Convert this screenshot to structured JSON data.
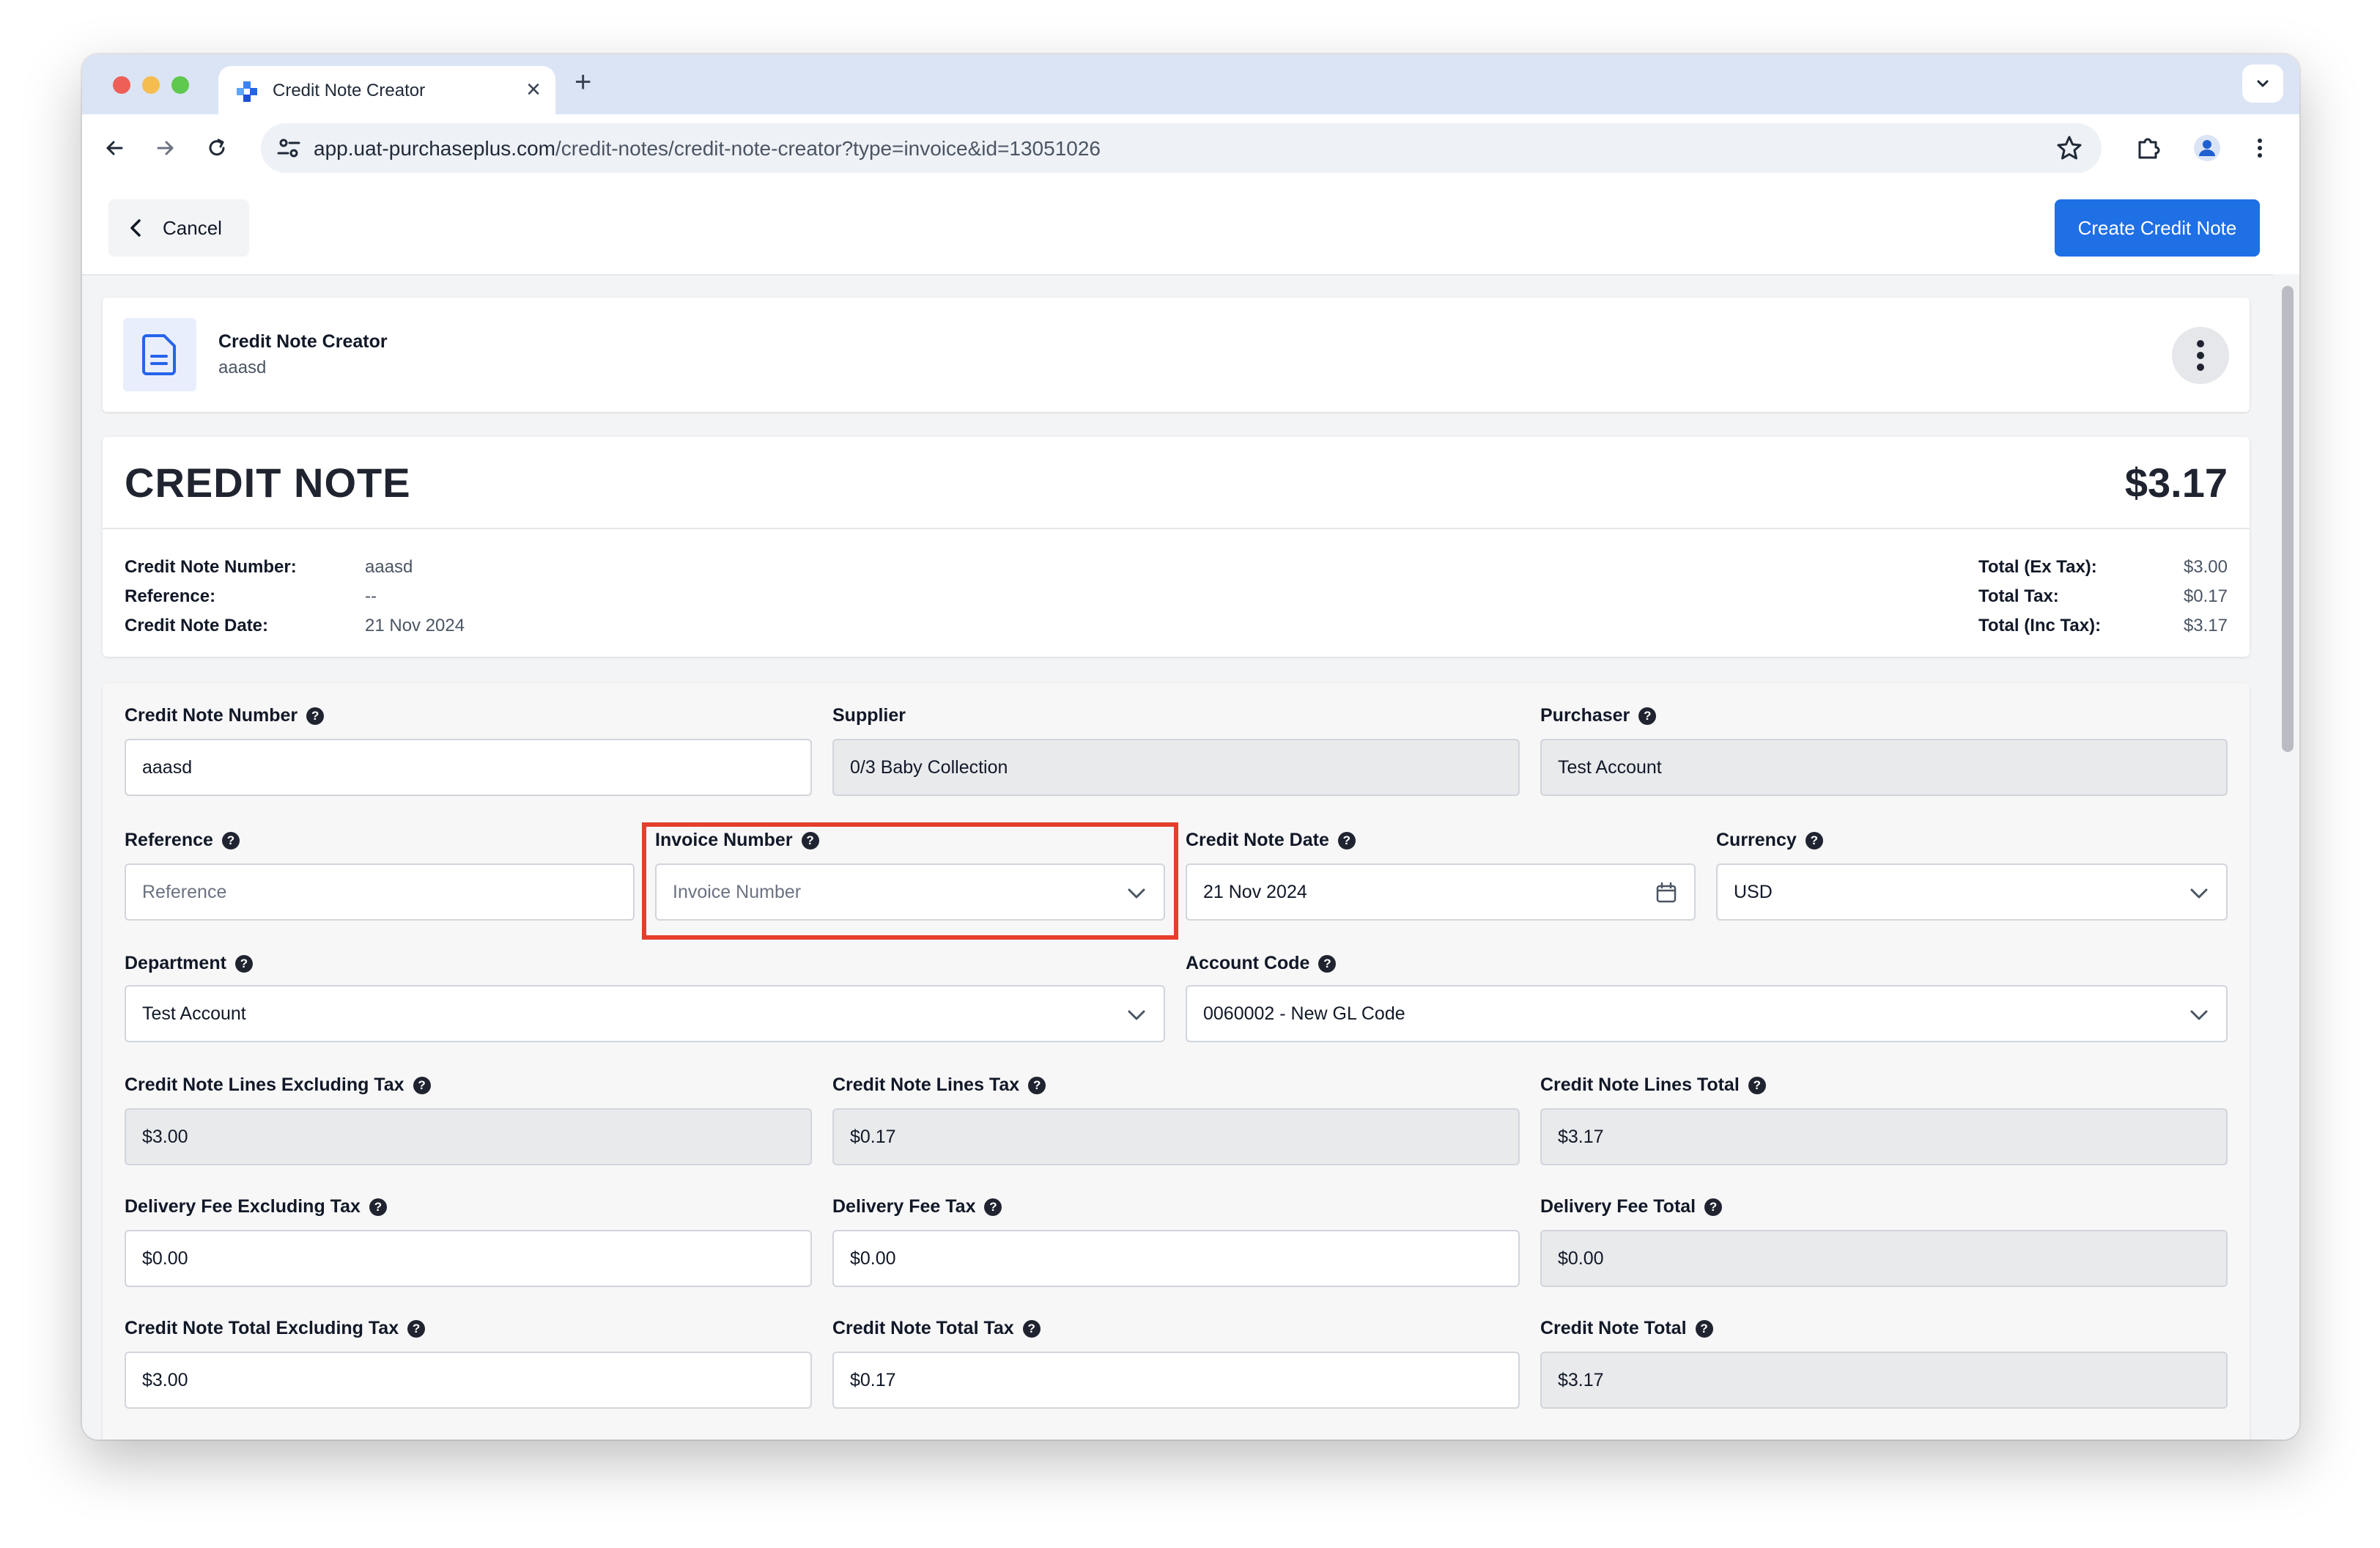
{
  "browser": {
    "tab_title": "Credit Note Creator",
    "url_host": "app.uat-purchaseplus.com",
    "url_path": "/credit-notes/credit-note-creator?type=invoice&id=13051026"
  },
  "toolbar": {
    "cancel_label": "Cancel",
    "create_label": "Create Credit Note"
  },
  "header": {
    "title": "Credit Note Creator",
    "subtitle": "aaasd"
  },
  "summary": {
    "title": "CREDIT NOTE",
    "amount": "$3.17",
    "left": [
      {
        "label": "Credit Note Number:",
        "value": "aaasd"
      },
      {
        "label": "Reference:",
        "value": "--"
      },
      {
        "label": "Credit Note Date:",
        "value": "21 Nov 2024"
      }
    ],
    "right": [
      {
        "label": "Total (Ex Tax):",
        "value": "$3.00"
      },
      {
        "label": "Total Tax:",
        "value": "$0.17"
      },
      {
        "label": "Total (Inc Tax):",
        "value": "$3.17"
      }
    ]
  },
  "form": {
    "credit_note_number": {
      "label": "Credit Note Number",
      "value": "aaasd"
    },
    "supplier": {
      "label": "Supplier",
      "value": "0/3 Baby Collection"
    },
    "purchaser": {
      "label": "Purchaser",
      "value": "Test Account"
    },
    "reference": {
      "label": "Reference",
      "placeholder": "Reference"
    },
    "invoice_number": {
      "label": "Invoice Number",
      "placeholder": "Invoice Number"
    },
    "credit_note_date": {
      "label": "Credit Note Date",
      "value": "21 Nov 2024"
    },
    "currency": {
      "label": "Currency",
      "value": "USD"
    },
    "department": {
      "label": "Department",
      "value": "Test Account"
    },
    "account_code": {
      "label": "Account Code",
      "value": "0060002 - New GL Code"
    },
    "lines_ex_tax": {
      "label": "Credit Note Lines Excluding Tax",
      "value": "$3.00"
    },
    "lines_tax": {
      "label": "Credit Note Lines Tax",
      "value": "$0.17"
    },
    "lines_total": {
      "label": "Credit Note Lines Total",
      "value": "$3.17"
    },
    "delivery_ex_tax": {
      "label": "Delivery Fee Excluding Tax",
      "value": "$0.00"
    },
    "delivery_tax": {
      "label": "Delivery Fee Tax",
      "value": "$0.00"
    },
    "delivery_total": {
      "label": "Delivery Fee Total",
      "value": "$0.00"
    },
    "total_ex_tax": {
      "label": "Credit Note Total Excluding Tax",
      "value": "$3.00"
    },
    "total_tax": {
      "label": "Credit Note Total Tax",
      "value": "$0.17"
    },
    "total": {
      "label": "Credit Note Total",
      "value": "$3.17"
    }
  },
  "colors": {
    "primary": "#1f6fe5",
    "highlight": "#e53e2b"
  }
}
